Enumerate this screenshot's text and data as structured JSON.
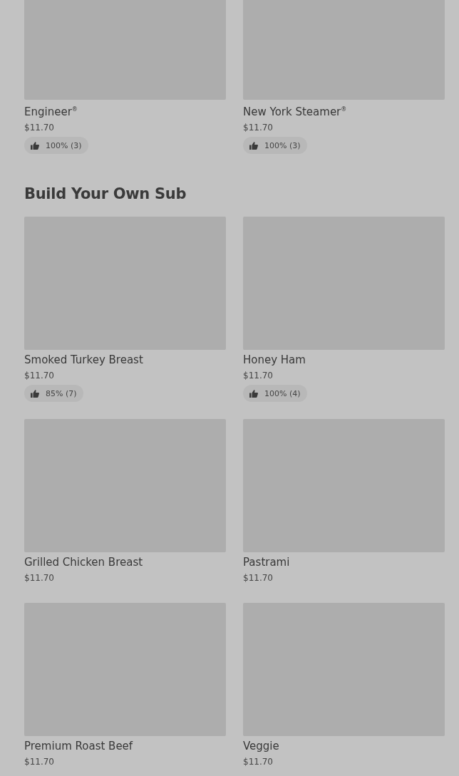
{
  "sections": [
    {
      "items": [
        {
          "name": "Engineer$^{®}$",
          "price": "$11.70",
          "rating": "100% (3)"
        },
        {
          "name": "New York Steamer$^{®}$",
          "price": "$11.70",
          "rating": "100% (3)"
        }
      ]
    },
    {
      "title": "Build Your Own Sub",
      "items": [
        {
          "name": "Smoked Turkey Breast",
          "price": "$11.70",
          "rating": "85% (7)"
        },
        {
          "name": "Honey Ham",
          "price": "$11.70",
          "rating": "100% (4)"
        },
        {
          "name": "Grilled Chicken Breast",
          "price": "$11.70"
        },
        {
          "name": "Pastrami",
          "price": "$11.70"
        },
        {
          "name": "Premium Roast Beef",
          "price": "$11.70"
        },
        {
          "name": "Veggie",
          "price": "$11.70"
        }
      ]
    }
  ]
}
